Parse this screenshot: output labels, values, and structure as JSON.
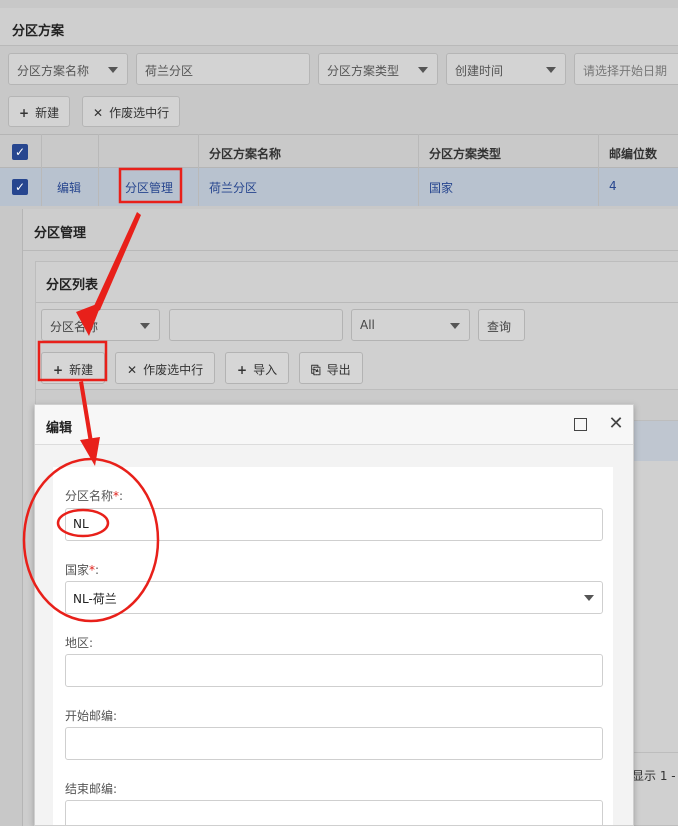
{
  "background_page": {
    "title": "分区方案",
    "filters": [
      {
        "label": "分区方案名称",
        "type": "select"
      },
      {
        "label": "荷兰分区",
        "type": "text"
      },
      {
        "label": "分区方案类型",
        "type": "select"
      },
      {
        "label": "创建时间",
        "type": "select"
      },
      {
        "label": "请选择开始日期",
        "type": "date"
      }
    ],
    "buttons": {
      "new": "新建",
      "void": "作废选中行"
    },
    "table": {
      "headers": [
        "分区方案名称",
        "分区方案类型",
        "邮编位数"
      ],
      "row": {
        "edit": "编辑",
        "manage": "分区管理",
        "name": "荷兰分区",
        "type": "国家",
        "digits": "4"
      }
    }
  },
  "partition_dialog": {
    "title": "分区管理",
    "subtitle": "分区列表",
    "filters": {
      "field": "分区名称",
      "value": "",
      "option": "All",
      "query": "查询"
    },
    "buttons": {
      "new": "新建",
      "void": "作废选中行",
      "import": "导入",
      "export": "导出"
    },
    "footer": "显示 1 -"
  },
  "edit_dialog": {
    "title": "编辑",
    "fields": {
      "partition_name": {
        "label": "分区名称",
        "required": "*",
        "colon": ":",
        "value": "NL"
      },
      "country": {
        "label": "国家",
        "required": "*",
        "colon": ":",
        "value": "NL-荷兰"
      },
      "region": {
        "label": "地区:",
        "value": ""
      },
      "start_zip": {
        "label": "开始邮编:",
        "value": ""
      },
      "end_zip": {
        "label": "结束邮编:",
        "value": ""
      }
    }
  },
  "colors": {
    "accent": "#27468f",
    "required": "#e0201a",
    "annotation": "#e8201a"
  }
}
